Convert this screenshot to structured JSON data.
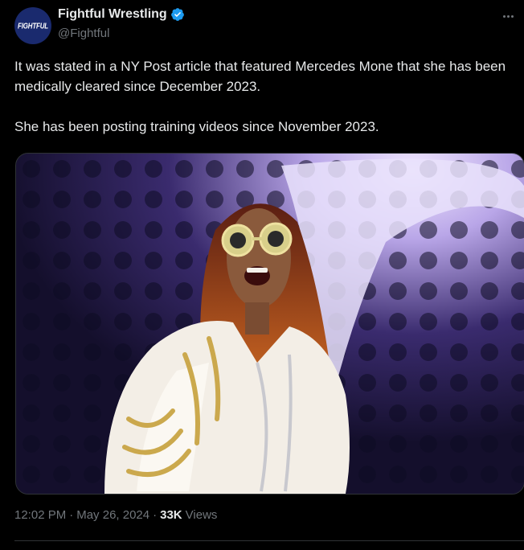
{
  "author": {
    "display_name": "Fightful Wrestling",
    "handle": "@Fightful",
    "avatar_text": "FIGHTFUL",
    "verified": true
  },
  "tweet": {
    "paragraph_1": "It was stated in a NY Post article that featured Mercedes Mone that she has been medically cleared since December 2023.",
    "paragraph_2": "She has been posting training videos since November 2023."
  },
  "meta": {
    "time": "12:02 PM",
    "separator": "·",
    "date": "May 26, 2024",
    "views_count": "33K",
    "views_label": "Views"
  },
  "icons": {
    "verified": "verified-badge-icon",
    "more": "more-options-icon"
  },
  "colors": {
    "background": "#000000",
    "text_primary": "#e7e9ea",
    "text_secondary": "#71767b",
    "verified_blue": "#1d9bf0",
    "avatar_bg": "#1a2a6e"
  }
}
